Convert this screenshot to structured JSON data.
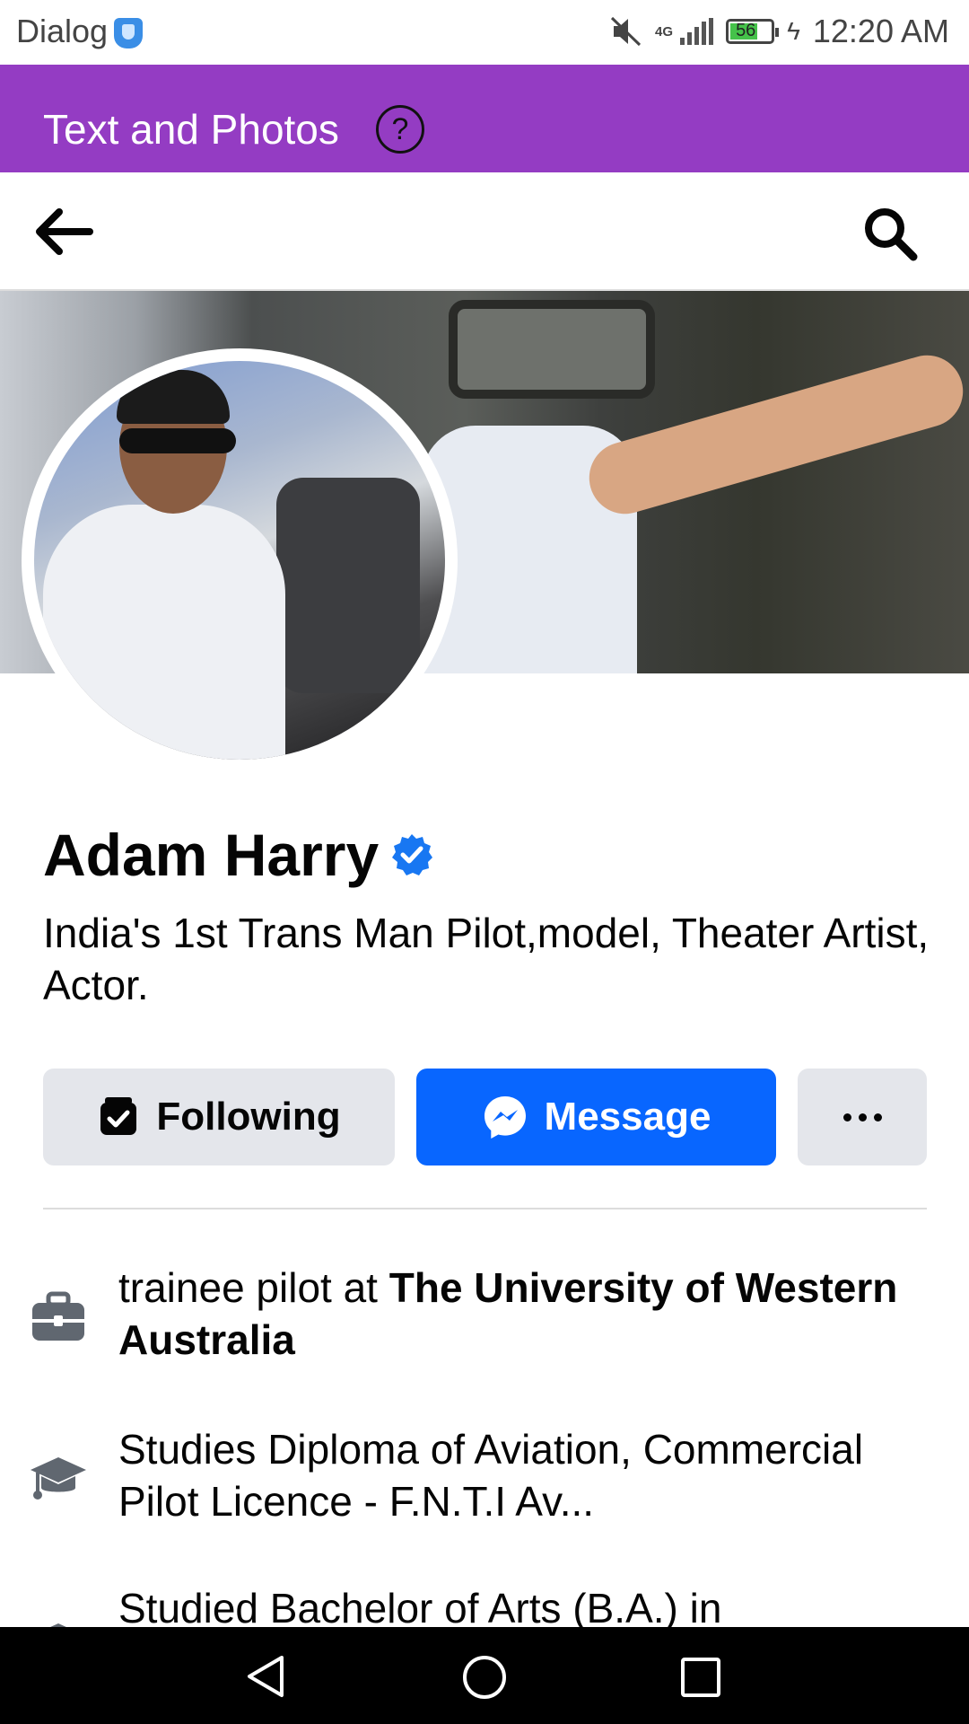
{
  "status_bar": {
    "carrier": "Dialog",
    "network": "4G",
    "battery": "56",
    "time": "12:20 AM"
  },
  "banner": {
    "title": "Text and Photos"
  },
  "profile": {
    "name": "Adam Harry",
    "verified": true,
    "bio": "India's 1st Trans Man Pilot,model, Theater Artist, Actor."
  },
  "actions": {
    "following_label": "Following",
    "message_label": "Message",
    "more_label": "more options"
  },
  "details": {
    "work_prefix": "trainee pilot at ",
    "work_org": "The University of Western Australia",
    "education_current": "Studies Diploma of Aviation, Commercial Pilot Licence - F.N.T.I Av...",
    "education_past": "Studied Bachelor of Arts (B.A.) in"
  },
  "colors": {
    "banner": "#943cc3",
    "message_button": "#0866ff",
    "secondary_button": "#e4e6eb",
    "verified": "#1877f2"
  },
  "icons": [
    "mute-icon",
    "signal-icon",
    "battery-icon",
    "help-icon",
    "back-arrow-icon",
    "search-icon",
    "verified-badge-icon",
    "following-check-icon",
    "messenger-icon",
    "more-dots-icon",
    "briefcase-icon",
    "graduation-cap-icon",
    "nav-back-icon",
    "nav-home-icon",
    "nav-recents-icon"
  ]
}
